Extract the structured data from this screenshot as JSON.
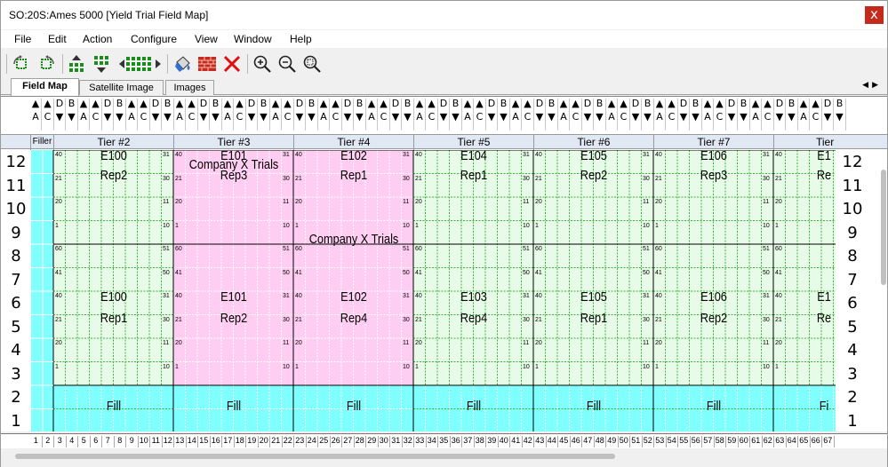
{
  "window": {
    "title": "SO:20S:Ames 5000 [Yield Trial Field Map]",
    "close_glyph": "x"
  },
  "menu": [
    "File",
    "Edit",
    "Action",
    "Configure",
    "View",
    "Window",
    "Help"
  ],
  "toolbar": {
    "icons": [
      "rotate-left-icon",
      "rotate-right-icon",
      "move-up-icon",
      "move-down-icon",
      "move-left-right-icon",
      "fill-bucket-icon",
      "brick-wall-icon",
      "delete-icon",
      "zoom-in-icon",
      "zoom-out-icon",
      "zoom-fit-icon"
    ]
  },
  "tabs": [
    {
      "label": "Field Map",
      "active": true
    },
    {
      "label": "Satellite Image",
      "active": false
    },
    {
      "label": "Images",
      "active": false
    }
  ],
  "header": {
    "filler_label": "Filler",
    "tiers": [
      "Tier #2",
      "Tier #3",
      "Tier #4",
      "Tier #5",
      "Tier #6",
      "Tier #7",
      "Tier"
    ]
  },
  "row_labels": [
    "12",
    "11",
    "10",
    "9",
    "8",
    "7",
    "6",
    "5",
    "4",
    "3",
    "2",
    "1"
  ],
  "overlay_labels": {
    "company_x_1": "Company X Trials",
    "company_x_2": "Company X Trials"
  },
  "plots_top": [
    {
      "entry": "E100",
      "rep": "Rep2"
    },
    {
      "entry": "E101",
      "rep": "Rep3"
    },
    {
      "entry": "E102",
      "rep": "Rep1"
    },
    {
      "entry": "E104",
      "rep": "Rep1"
    },
    {
      "entry": "E105",
      "rep": "Rep2"
    },
    {
      "entry": "E106",
      "rep": "Rep3"
    },
    {
      "entry": "E1",
      "rep": "Re"
    }
  ],
  "plots_bottom": [
    {
      "entry": "E100",
      "rep": "Rep1"
    },
    {
      "entry": "E101",
      "rep": "Rep2"
    },
    {
      "entry": "E102",
      "rep": "Rep4"
    },
    {
      "entry": "E103",
      "rep": "Rep4"
    },
    {
      "entry": "E105",
      "rep": "Rep1"
    },
    {
      "entry": "E106",
      "rep": "Rep2"
    },
    {
      "entry": "E1",
      "rep": "Re"
    }
  ],
  "fill_label": "Fill",
  "fill_label_partial": "Fi",
  "small_numbers_left": [
    "40",
    "21",
    "20",
    "1",
    "60",
    "41",
    "40",
    "21",
    "20",
    "1"
  ],
  "small_numbers_right": [
    "31",
    "30",
    "11",
    "10",
    "51",
    "50",
    "31",
    "30",
    "11",
    "10"
  ],
  "column_numbers": [
    "1",
    "2",
    "3",
    "4",
    "5",
    "6",
    "7",
    "8",
    "9",
    "10",
    "11",
    "12",
    "13",
    "14",
    "15",
    "16",
    "17",
    "18",
    "19",
    "20",
    "21",
    "22",
    "23",
    "24",
    "25",
    "26",
    "27",
    "28",
    "29",
    "30",
    "31",
    "32",
    "33",
    "34",
    "35",
    "36",
    "37",
    "38",
    "39",
    "40",
    "41",
    "42",
    "43",
    "44",
    "45",
    "46",
    "47",
    "48",
    "49",
    "50",
    "51",
    "52",
    "53",
    "54",
    "55",
    "56",
    "57",
    "58",
    "59",
    "60",
    "61",
    "62",
    "63",
    "64",
    "65",
    "66",
    "67"
  ],
  "colors": {
    "green_plot": "#e8fbe8",
    "pink_plot": "#ffccf2",
    "fill_cyan": "#80ffff",
    "grid_dot": "#3cb43c",
    "header_blue": "#e0e8f4"
  }
}
